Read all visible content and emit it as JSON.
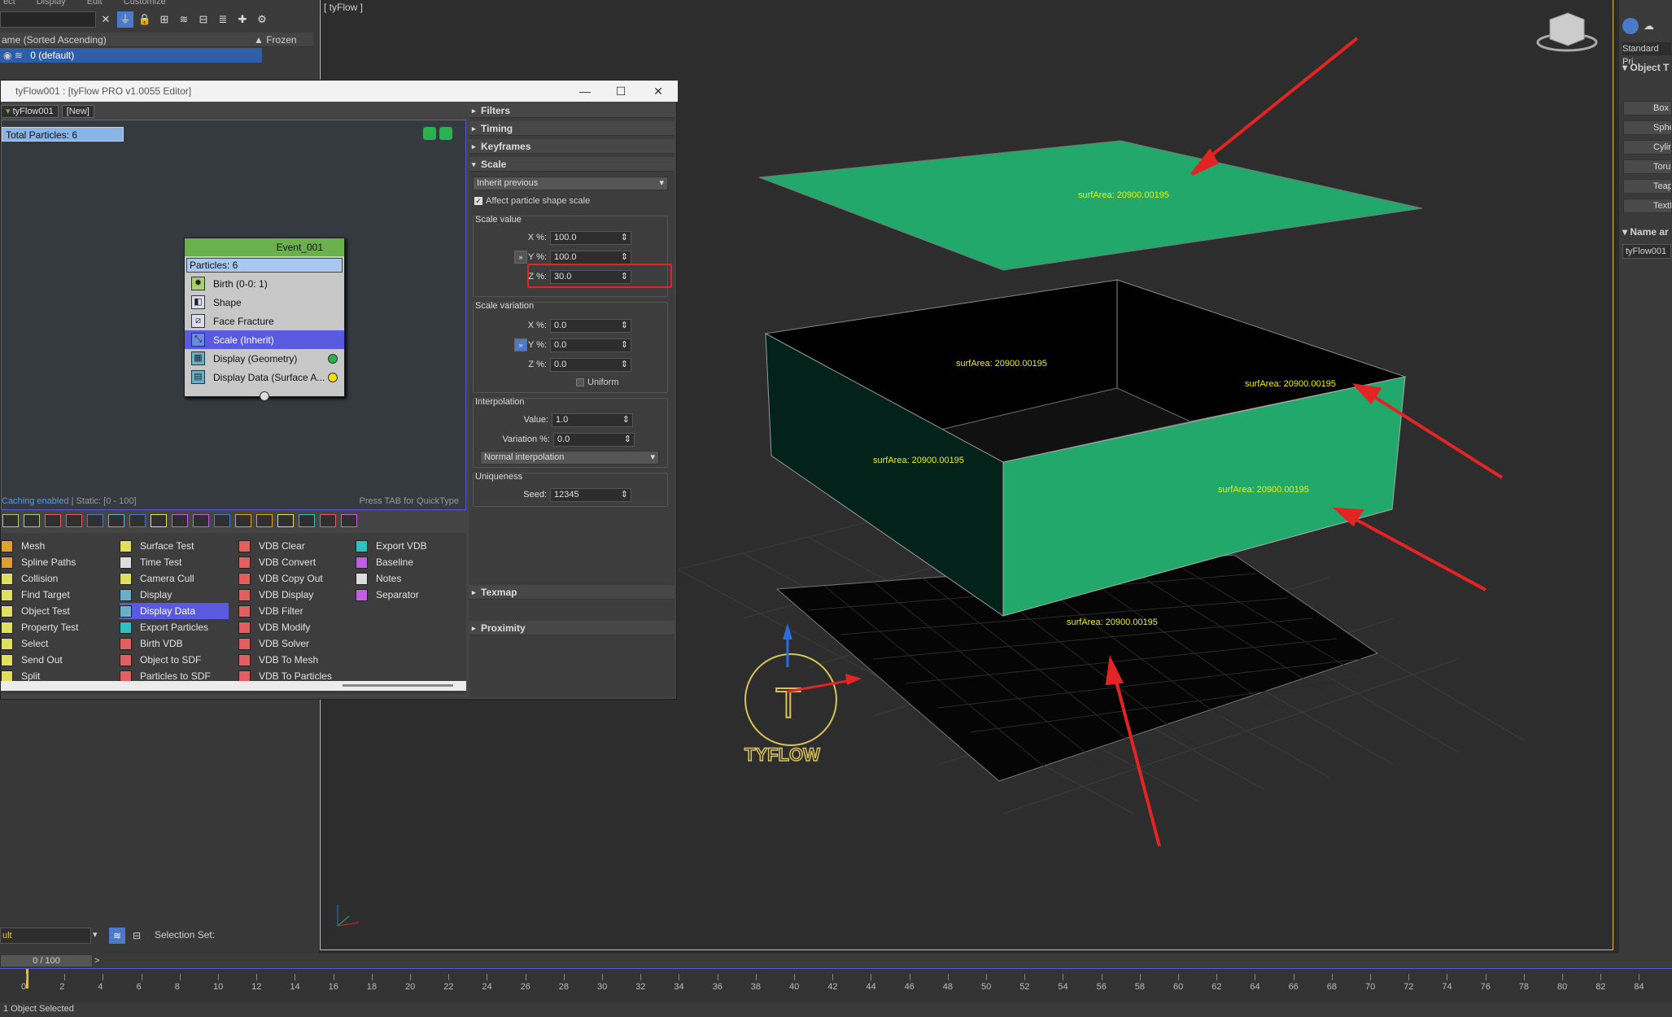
{
  "top_menu": [
    "ect",
    "Display",
    "Edit",
    "Customize"
  ],
  "scene_explorer": {
    "column_name": "ame (Sorted Ascending)",
    "column_frozen": "▲ Frozen",
    "layer": "0 (default)"
  },
  "editor": {
    "title": "tyFlow001 : [tyFlow PRO v1.0055 Editor]",
    "tabs": [
      "tyFlow001",
      "[New]"
    ],
    "total_particles": "Total Particles: 6",
    "event": {
      "name": "Event_001",
      "particles": "Particles: 6",
      "operators": [
        {
          "label": "Birth (0-0: 1)",
          "selected": false
        },
        {
          "label": "Shape",
          "selected": false
        },
        {
          "label": "Face Fracture",
          "selected": false
        },
        {
          "label": "Scale (Inherit)",
          "selected": true
        },
        {
          "label": "Display (Geometry)",
          "selected": false
        },
        {
          "label": "Display Data (Surface A...",
          "selected": false
        }
      ]
    },
    "caching": "Caching enabled",
    "static_info": " | Static: [0 - 100]",
    "quicktype": "Press TAB for QuickType",
    "palette": {
      "col1": [
        "Mesh",
        "Spline Paths",
        "Collision",
        "Find Target",
        "Object Test",
        "Property Test",
        "Select",
        "Send Out",
        "Split"
      ],
      "col2": [
        "Surface Test",
        "Time Test",
        "Camera Cull",
        "Display",
        "Display Data",
        "Export Particles",
        "Birth VDB",
        "Object to SDF",
        "Particles to SDF"
      ],
      "col3": [
        "VDB Clear",
        "VDB Convert",
        "VDB Copy Out",
        "VDB Display",
        "VDB Filter",
        "VDB Modify",
        "VDB Solver",
        "VDB To Mesh",
        "VDB To Particles"
      ],
      "col4": [
        "Export VDB",
        "Baseline",
        "Notes",
        "Separator"
      ],
      "selected": "Display Data"
    }
  },
  "props": {
    "rollouts": [
      "Filters",
      "Timing",
      "Keyframes",
      "Scale"
    ],
    "scale_mode": "Inherit previous",
    "affect_shape": "Affect particle shape scale",
    "scale_value_label": "Scale value",
    "scale_value": {
      "x_label": "X %:",
      "x": "100.0",
      "y_label": "Y %:",
      "y": "100.0",
      "z_label": "Z %:",
      "z": "30.0"
    },
    "scale_variation_label": "Scale variation",
    "scale_variation": {
      "x_label": "X %:",
      "x": "0.0",
      "y_label": "Y %:",
      "y": "0.0",
      "z_label": "Z %:",
      "z": "0.0"
    },
    "uniform": "Uniform",
    "interpolation_label": "Interpolation",
    "interp_value_label": "Value:",
    "interp_value": "1.0",
    "interp_var_label": "Variation %:",
    "interp_var": "0.0",
    "interp_mode": "Normal interpolation",
    "uniqueness_label": "Uniqueness",
    "seed_label": "Seed:",
    "seed": "12345",
    "bottom_rollouts": [
      "Texmap",
      "Proximity"
    ]
  },
  "viewport": {
    "label": "[ tyFlow ]",
    "surf_labels": [
      "surfArea: 20900.00195",
      "surfArea: 20900.00195",
      "surfArea: 20900.00195",
      "surfArea: 20900.00195",
      "surfArea: 20900.00195",
      "surfArea: 20900.00195"
    ],
    "logo_text": "TYFLOW"
  },
  "command_panel": {
    "dropdown": "Standard Pri",
    "section1": "Object T",
    "buttons": [
      "Box",
      "Sphe",
      "Cylind",
      "Toru",
      "Teap",
      "TextP"
    ],
    "section2": "Name ar",
    "name_value": "tyFlow001"
  },
  "bottom": {
    "layer_field": "ult",
    "selection_set_label": "Selection Set:",
    "frame_counter": "0 / 100",
    "next_arrow": ">",
    "status_left": "1 Object Selected",
    "ticks": [
      "0",
      "2",
      "4",
      "6",
      "8",
      "10",
      "12",
      "14",
      "16",
      "18",
      "20",
      "22",
      "24",
      "26",
      "28",
      "30",
      "32",
      "34",
      "36",
      "38",
      "40",
      "42",
      "44",
      "46",
      "48",
      "50",
      "52",
      "54",
      "56",
      "58",
      "60",
      "62",
      "64",
      "66",
      "68",
      "70",
      "72",
      "74",
      "76",
      "78",
      "80",
      "82",
      "84"
    ]
  },
  "colors": {
    "accent_blue": "#5a5ae0",
    "event_green": "#6ab04c",
    "plane_green": "#22a86a",
    "label_yellow": "#f0f000",
    "arrow_red": "#e32424",
    "viewport_border": "#d9c25a"
  }
}
